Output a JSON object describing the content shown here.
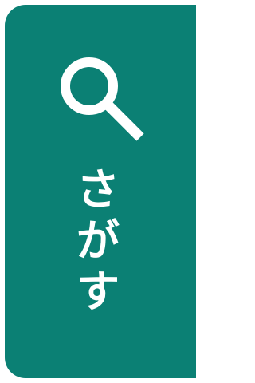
{
  "search_tab": {
    "label_chars": [
      "さ",
      "が",
      "す"
    ],
    "icon": "search-icon",
    "colors": {
      "background": "#0b8074",
      "foreground": "#ffffff"
    }
  }
}
